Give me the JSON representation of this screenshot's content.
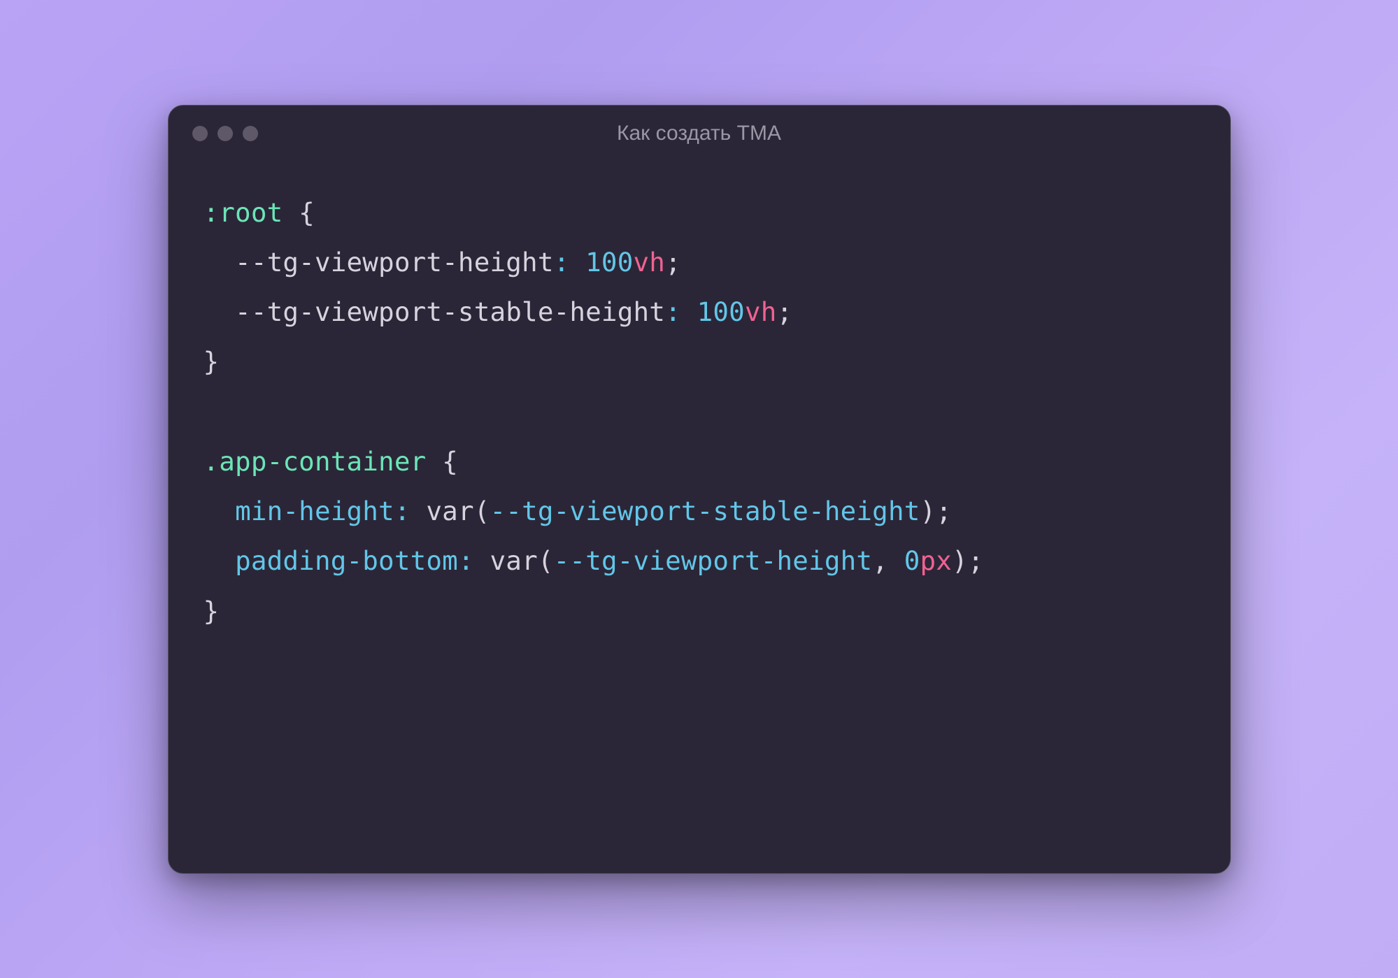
{
  "window": {
    "title": "Как создать TMA"
  },
  "code": {
    "lines": [
      {
        "tokens": [
          {
            "cls": "tok-selector",
            "t": ":root"
          },
          {
            "cls": "tok-punct",
            "t": " {"
          }
        ]
      },
      {
        "tokens": [
          {
            "cls": "tok-punct",
            "t": "  --tg-viewport-height"
          },
          {
            "cls": "tok-op",
            "t": ":"
          },
          {
            "cls": "tok-punct",
            "t": " "
          },
          {
            "cls": "tok-num",
            "t": "100"
          },
          {
            "cls": "tok-unit",
            "t": "vh"
          },
          {
            "cls": "tok-punct",
            "t": ";"
          }
        ]
      },
      {
        "tokens": [
          {
            "cls": "tok-punct",
            "t": "  --tg-viewport-stable-height"
          },
          {
            "cls": "tok-op",
            "t": ":"
          },
          {
            "cls": "tok-punct",
            "t": " "
          },
          {
            "cls": "tok-num",
            "t": "100"
          },
          {
            "cls": "tok-unit",
            "t": "vh"
          },
          {
            "cls": "tok-punct",
            "t": ";"
          }
        ]
      },
      {
        "tokens": [
          {
            "cls": "tok-punct",
            "t": "}"
          }
        ]
      },
      {
        "tokens": [
          {
            "cls": "",
            "t": " "
          }
        ]
      },
      {
        "tokens": [
          {
            "cls": "tok-selector",
            "t": ".app-container"
          },
          {
            "cls": "tok-punct",
            "t": " {"
          }
        ]
      },
      {
        "tokens": [
          {
            "cls": "tok-punct",
            "t": "  "
          },
          {
            "cls": "tok-prop",
            "t": "min-height"
          },
          {
            "cls": "tok-op",
            "t": ":"
          },
          {
            "cls": "tok-punct",
            "t": " "
          },
          {
            "cls": "tok-func",
            "t": "var"
          },
          {
            "cls": "tok-punct",
            "t": "("
          },
          {
            "cls": "tok-prop",
            "t": "--tg-viewport-stable-height"
          },
          {
            "cls": "tok-punct",
            "t": ");"
          }
        ]
      },
      {
        "tokens": [
          {
            "cls": "tok-punct",
            "t": "  "
          },
          {
            "cls": "tok-prop",
            "t": "padding-bottom"
          },
          {
            "cls": "tok-op",
            "t": ":"
          },
          {
            "cls": "tok-punct",
            "t": " "
          },
          {
            "cls": "tok-func",
            "t": "var"
          },
          {
            "cls": "tok-punct",
            "t": "("
          },
          {
            "cls": "tok-prop",
            "t": "--tg-viewport-height"
          },
          {
            "cls": "tok-punct",
            "t": ", "
          },
          {
            "cls": "tok-num",
            "t": "0"
          },
          {
            "cls": "tok-unit",
            "t": "px"
          },
          {
            "cls": "tok-punct",
            "t": ");"
          }
        ]
      },
      {
        "tokens": [
          {
            "cls": "tok-punct",
            "t": "}"
          }
        ]
      }
    ]
  }
}
